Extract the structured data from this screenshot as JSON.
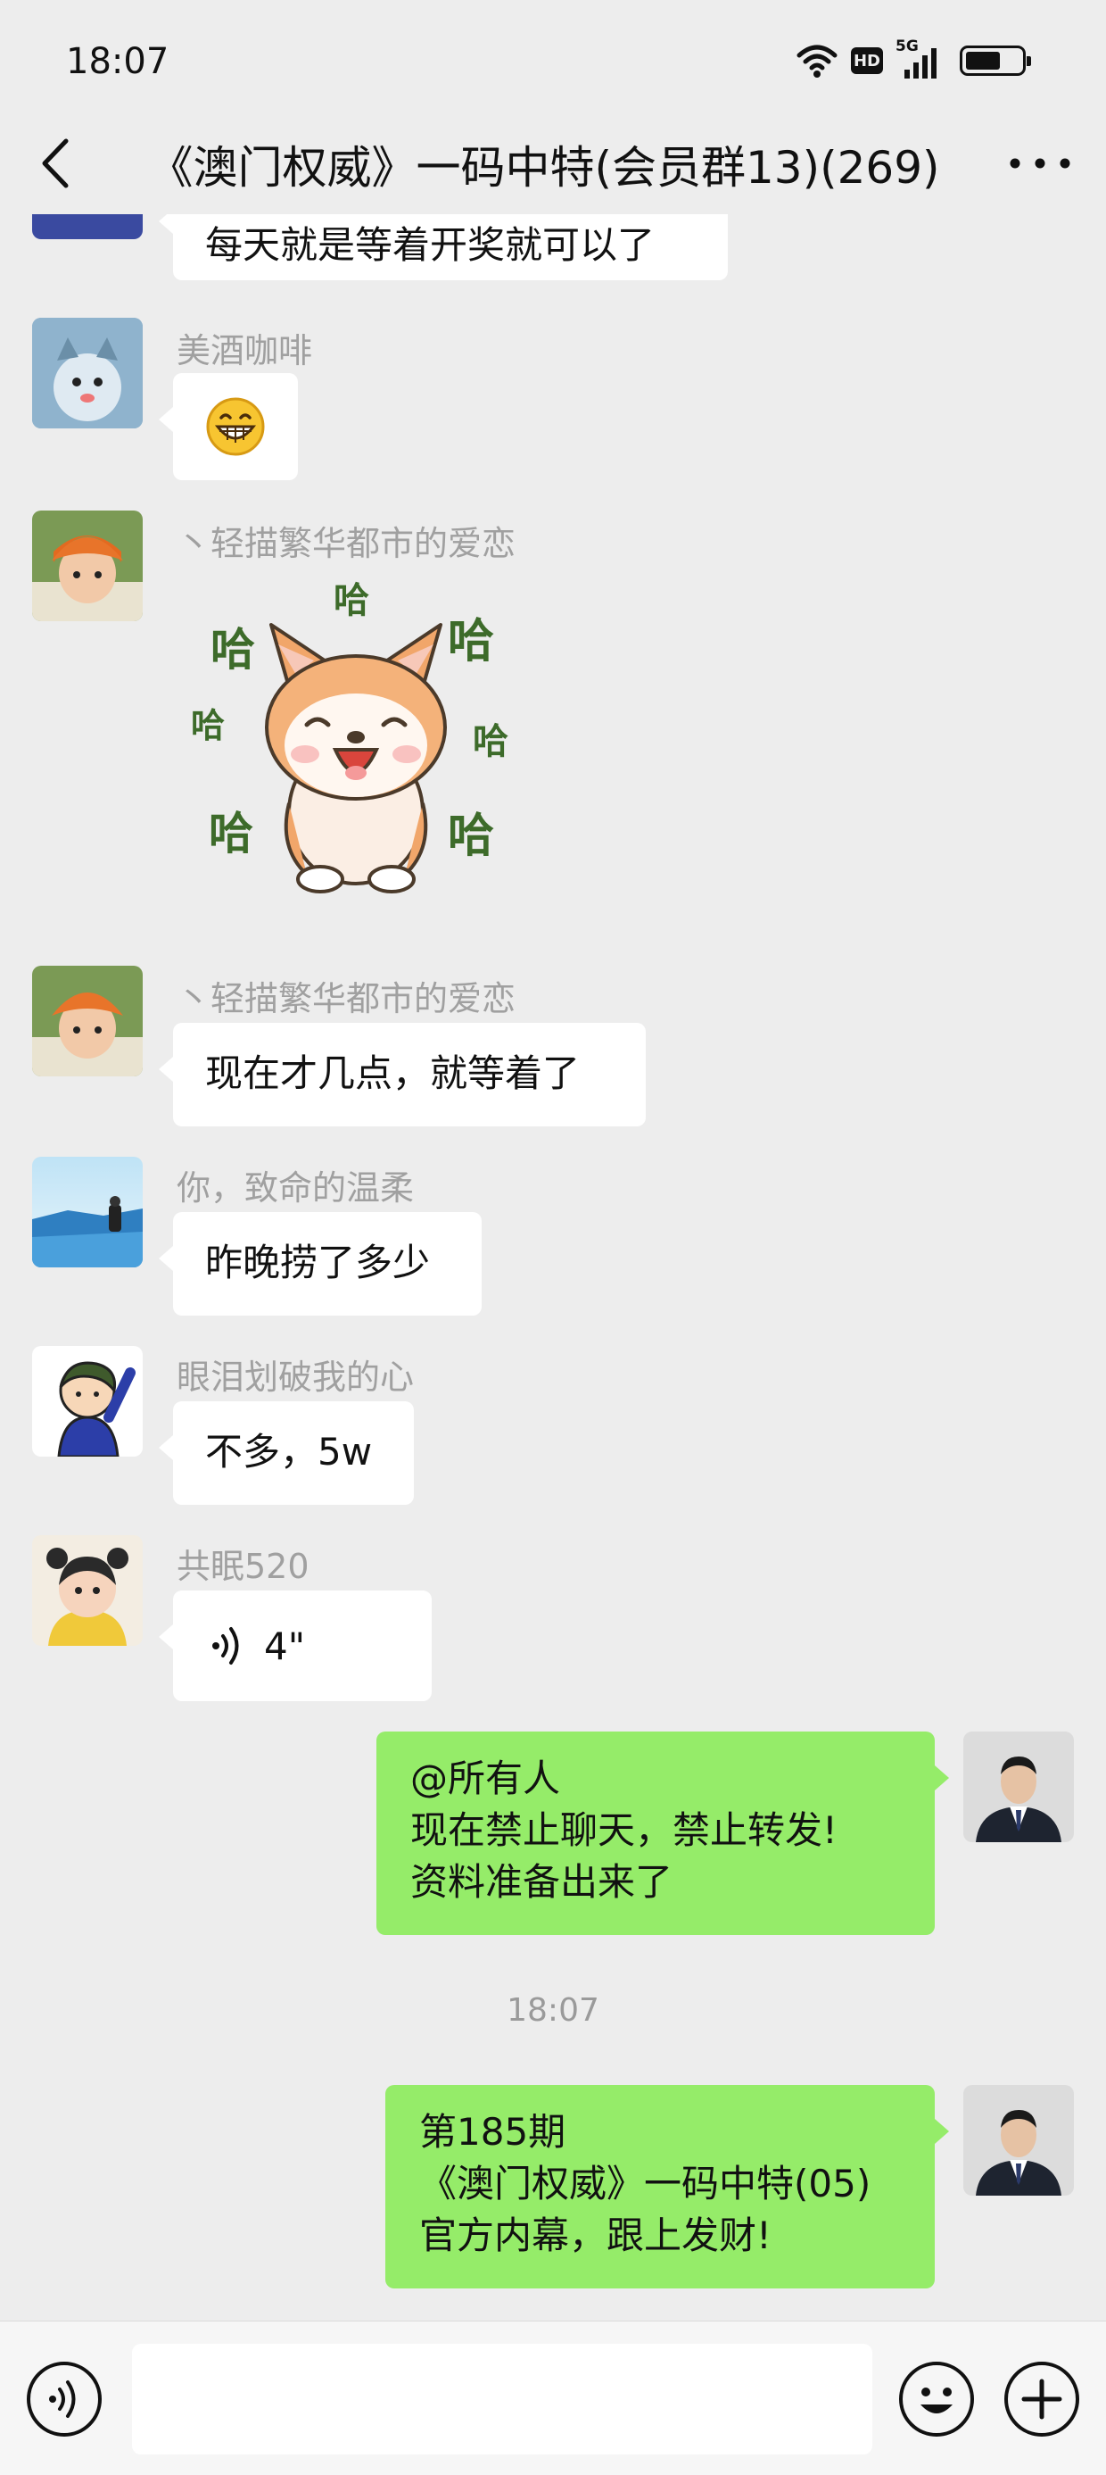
{
  "status_bar": {
    "time": "18:07",
    "hd_badge": "HD",
    "network": "5G",
    "icons": [
      "wifi-icon",
      "hd-icon",
      "signal-5g-icon",
      "battery-icon"
    ]
  },
  "nav": {
    "back_icon": "chevron-left-icon",
    "title": "《澳门权威》一码中特(会员群13)(269)",
    "more_icon": "more-dots-icon"
  },
  "messages": {
    "partial": {
      "text": "每天就是等着开奖就可以了"
    },
    "m1": {
      "sender": "美酒咖啡",
      "content": "😁"
    },
    "m2": {
      "sender": "丶轻描繁华都市的爱恋",
      "sticker": "shiba-laughing-sticker",
      "laugh_char": "哈"
    },
    "m3": {
      "sender": "丶轻描繁华都市的爱恋",
      "text": "现在才几点，就等着了"
    },
    "m4": {
      "sender": "你，致命的温柔",
      "text": "昨晚捞了多少"
    },
    "m5": {
      "sender": "眼泪划破我的心",
      "text": "不多，5w"
    },
    "m6": {
      "sender": "共眠520",
      "voice_duration": "4\""
    },
    "m7": {
      "text": "@所有人\n现在禁止聊天，禁止转发!\n资料准备出来了"
    },
    "timestamp": "18:07",
    "m8": {
      "text": "第185期\n《澳门权威》一码中特(05)\n官方内幕，跟上发财!"
    }
  },
  "input_bar": {
    "voice_icon": "voice-input-icon",
    "emoji_icon": "emoji-icon",
    "plus_icon": "plus-icon"
  },
  "colors": {
    "background": "#ededed",
    "bubble_incoming": "#ffffff",
    "bubble_outgoing": "#95ec69",
    "sender_name": "#a0a0a0"
  }
}
